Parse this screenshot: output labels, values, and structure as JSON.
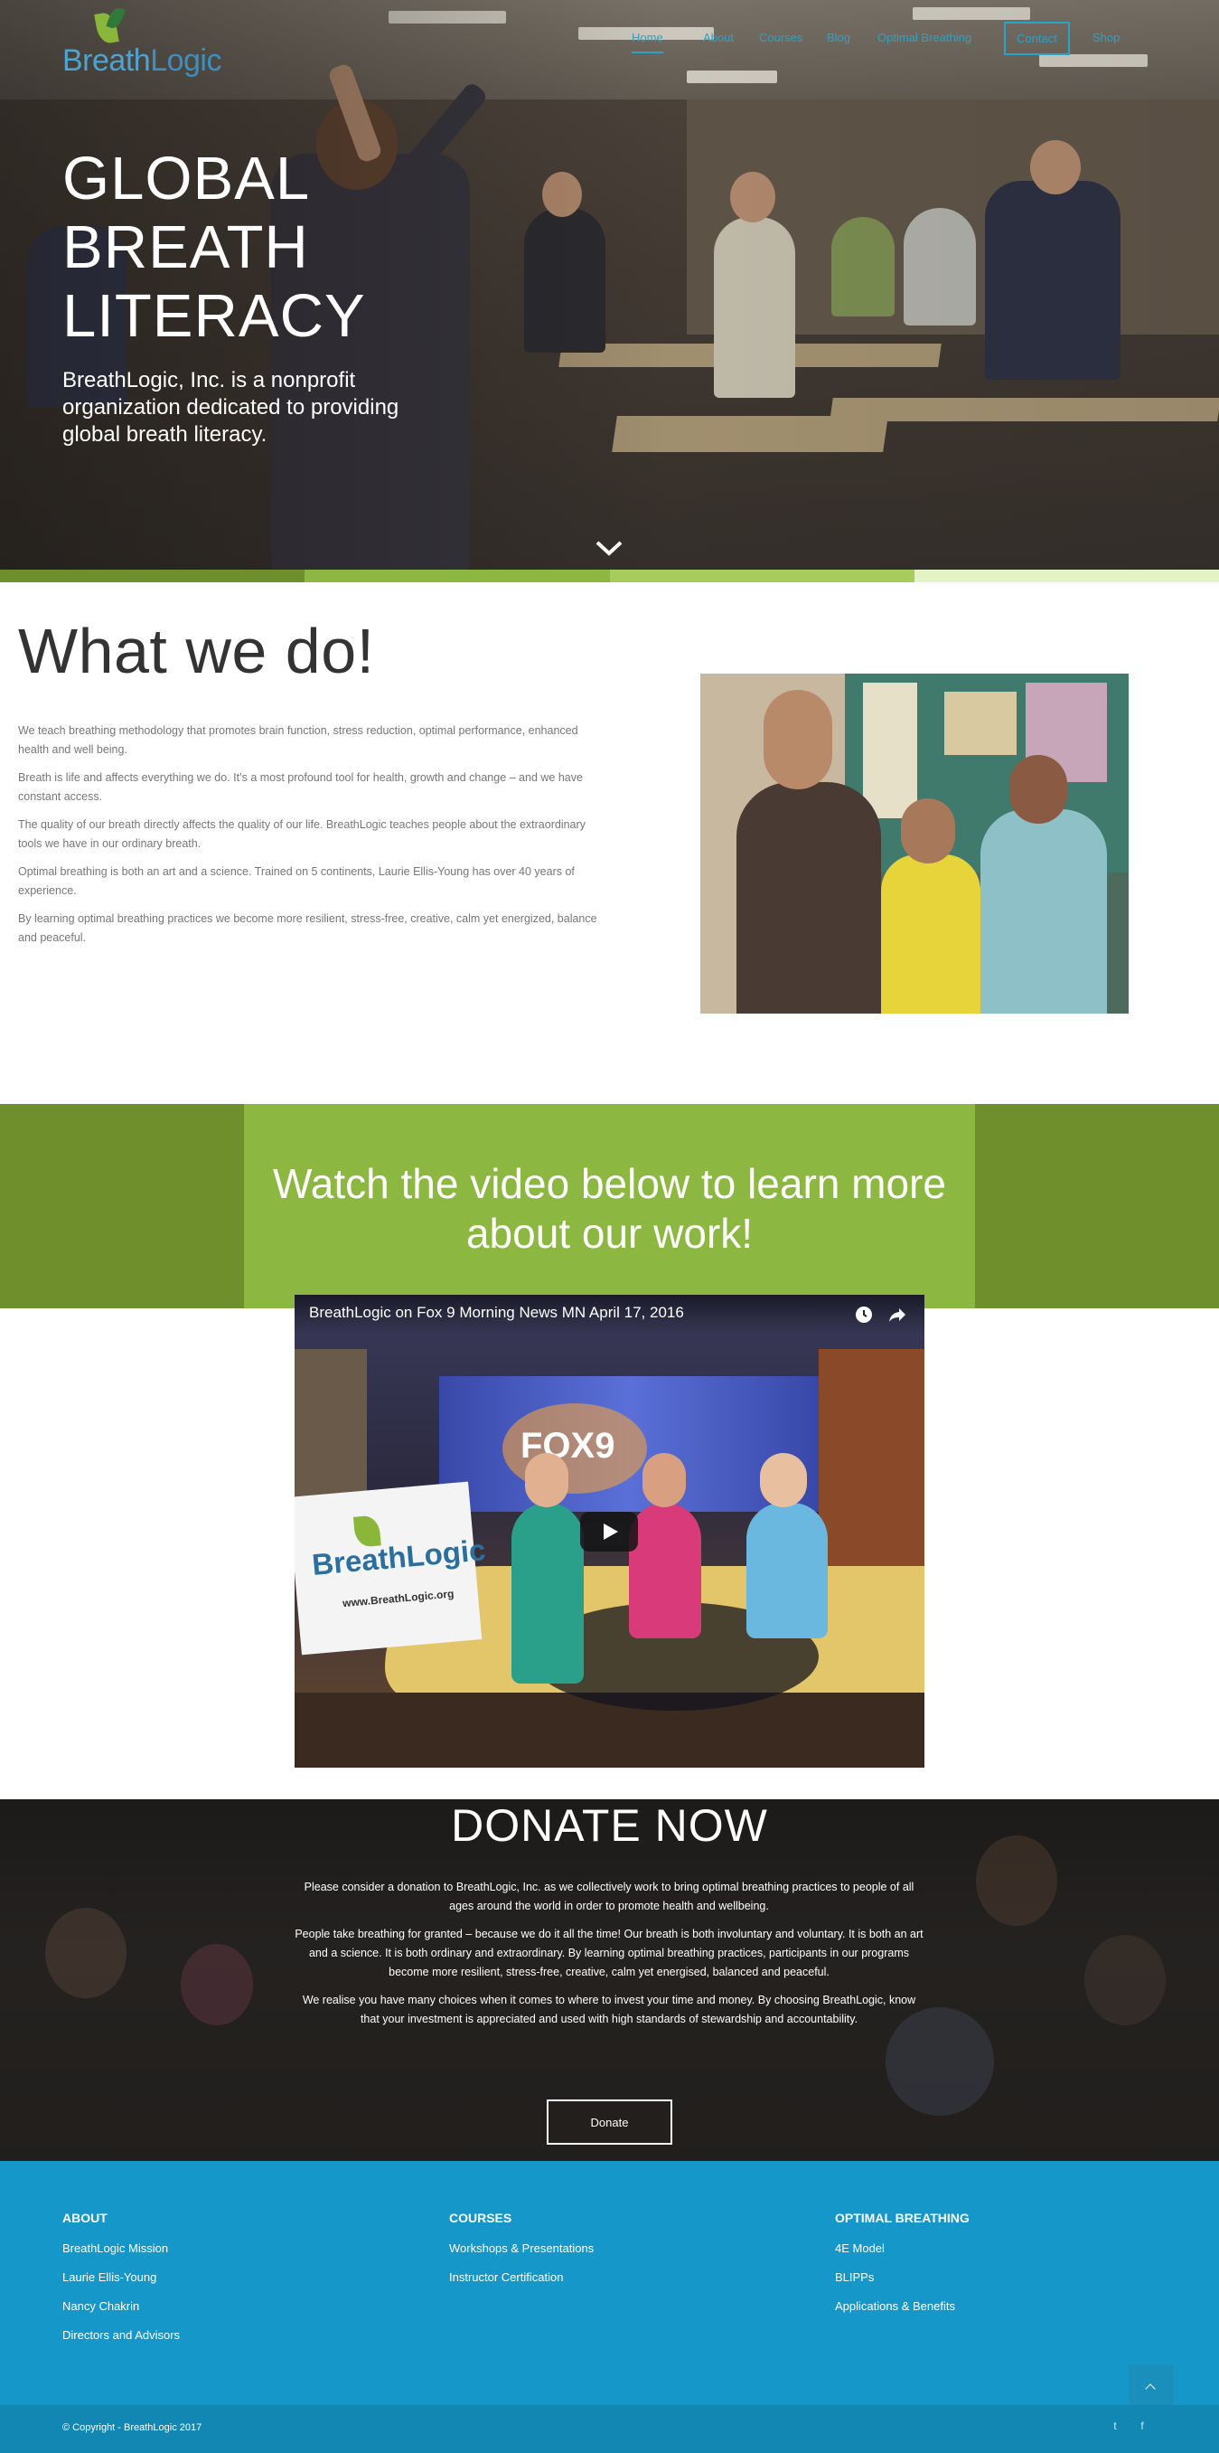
{
  "brand": {
    "logo_text_light": "Breath",
    "logo_text_dark": "Logic",
    "color_primary": "#2aa3c9",
    "color_green": "#8cb740",
    "color_dark_green": "#6f8f2c",
    "color_footer": "#1598c9"
  },
  "nav": {
    "items": [
      {
        "label": "Home"
      },
      {
        "label": "About"
      },
      {
        "label": "Courses"
      },
      {
        "label": "Blog"
      },
      {
        "label": "Optimal Breathing"
      },
      {
        "label": "Contact"
      },
      {
        "label": "Shop"
      }
    ],
    "active": "Home"
  },
  "hero": {
    "title": "GLOBAL BREATH LITERACY",
    "subtitle": "BreathLogic, Inc. is a nonprofit organization dedicated to providing global breath literacy.",
    "scroll_icon": "chevron-down-icon",
    "band_colors": [
      "#6f8f2c",
      "#8cb740",
      "#a8cc5c",
      "#e4f3c4"
    ]
  },
  "what_we_do": {
    "title": "What we do!",
    "paragraphs": [
      "We teach breathing methodology that promotes brain function, stress reduction, optimal performance, enhanced health and well being.",
      "Breath is life and affects everything we do. It’s a most profound tool for health, growth and change  – and we have constant access.",
      "The quality of our breath directly affects the quality of our life. BreathLogic teaches people about the extraordinary tools we have in our ordinary breath.",
      "Optimal breathing is both an art and a science. Trained on 5 continents, Laurie Ellis-Young has over 40 years of experience.",
      "By learning optimal breathing practices we become more resilient, stress-free, creative, calm yet energized, balance and peaceful."
    ]
  },
  "video_section": {
    "title": "Watch the video below to learn more about our work!",
    "video_title": "BreathLogic on Fox 9 Morning News MN April 17, 2016",
    "sign_text": "BreathLogic",
    "sign_url": "www.BreathLogic.org",
    "studio_logo": "FOX9",
    "icons": [
      "clock-icon",
      "share-icon",
      "play-icon"
    ]
  },
  "donate": {
    "title": "DONATE NOW",
    "paragraphs": [
      "Please consider a donation to BreathLogic, Inc. as we collectively work to bring optimal breathing practices to people of all ages around the world in order to promote health and wellbeing.",
      "People take breathing for granted – because we do it all the time! Our breath is both involuntary and voluntary. It is both an art and a science. It is both ordinary and extraordinary. By learning optimal breathing practices, participants in our programs become more resilient, stress-free, creative, calm yet energised, balanced and peaceful.",
      "We realise you have many choices when it comes to where to invest your time and money. By choosing BreathLogic, know that your investment is appreciated and used with high standards of stewardship and accountability."
    ],
    "button_label": "Donate"
  },
  "footer": {
    "columns": [
      {
        "heading": "ABOUT",
        "links": [
          "BreathLogic Mission",
          "Laurie Ellis-Young",
          "Nancy Chakrin",
          "Directors and Advisors"
        ]
      },
      {
        "heading": "COURSES",
        "links": [
          "Workshops & Presentations",
          "Instructor Certification"
        ]
      },
      {
        "heading": "OPTIMAL BREATHING",
        "links": [
          "4E Model",
          "BLIPPs",
          "Applications & Benefits"
        ]
      }
    ],
    "copyright": "© Copyright - BreathLogic 2017",
    "social": [
      {
        "icon": "twitter-icon",
        "glyph": "t"
      },
      {
        "icon": "facebook-icon",
        "glyph": "f"
      }
    ],
    "back_to_top_icon": "chevron-up-icon"
  }
}
